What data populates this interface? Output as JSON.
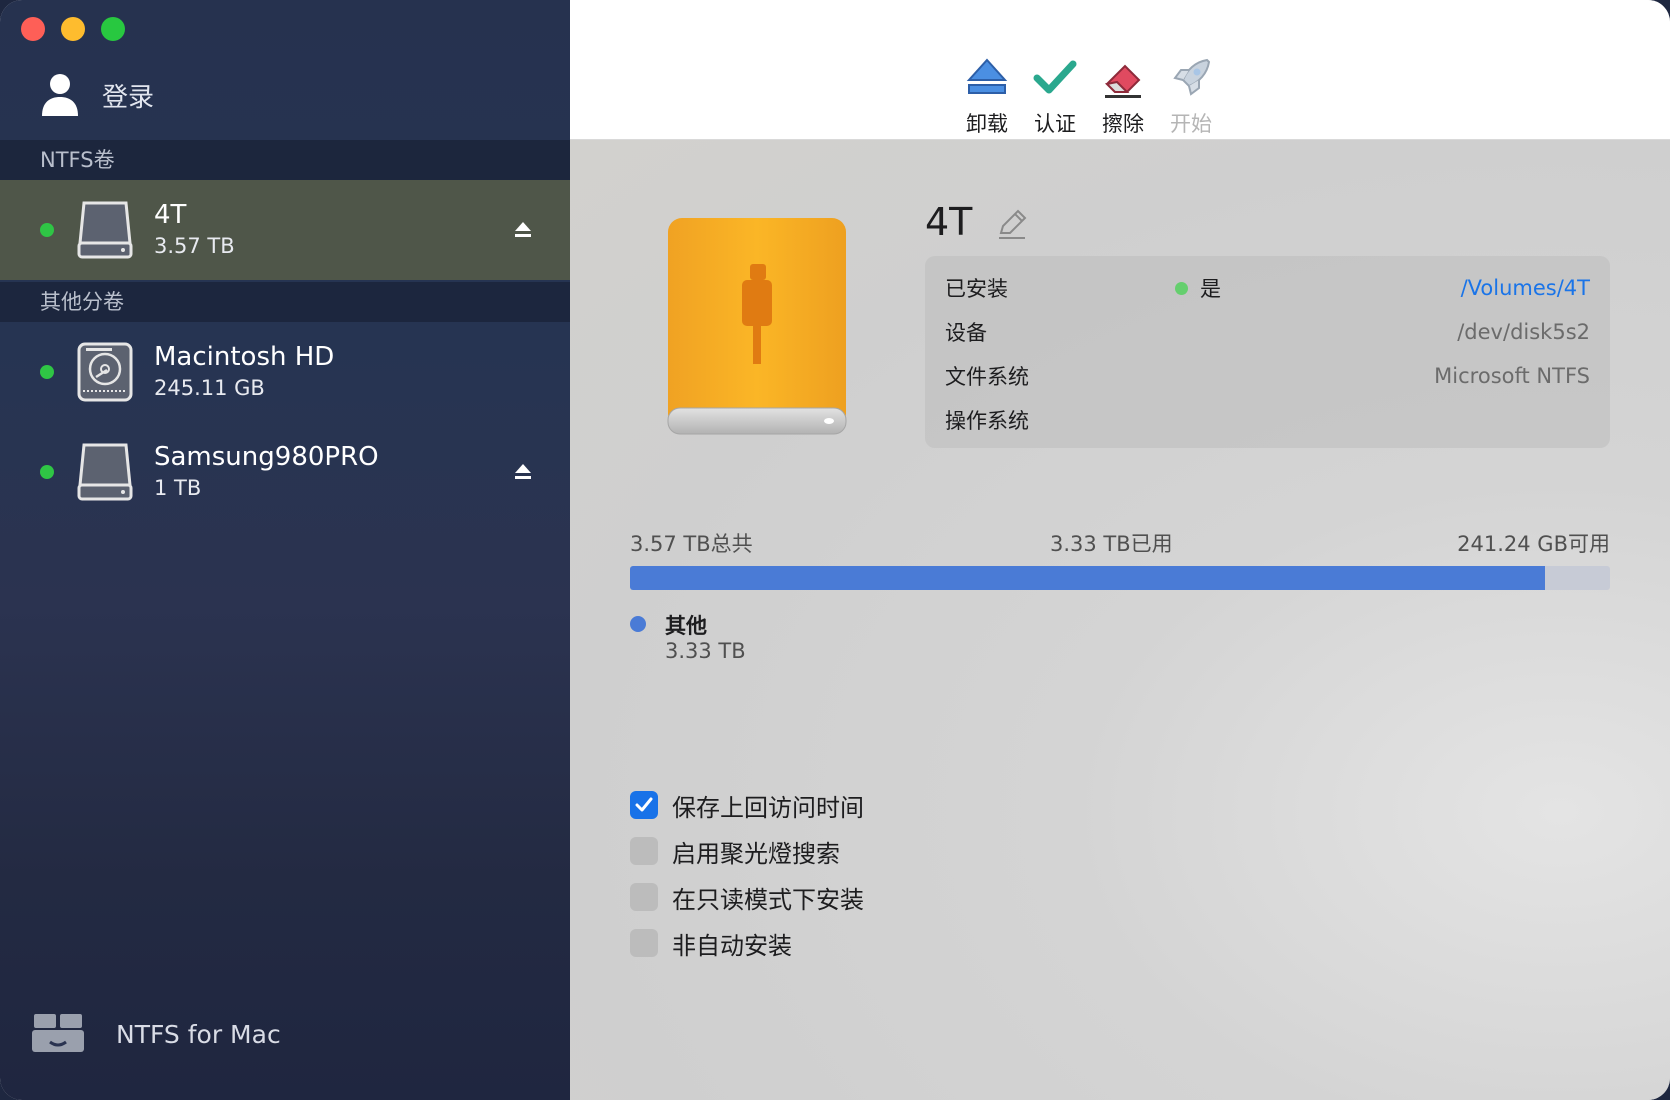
{
  "sidebar": {
    "login_label": "登录",
    "sections": [
      {
        "header": "NTFS卷",
        "volumes": [
          {
            "name": "4T",
            "size": "3.57 TB",
            "selected": true,
            "ejectable": true
          }
        ]
      },
      {
        "header": "其他分卷",
        "volumes": [
          {
            "name": "Macintosh HD",
            "size": "245.11 GB",
            "selected": false,
            "ejectable": false
          },
          {
            "name": "Samsung980PRO",
            "size": "1 TB",
            "selected": false,
            "ejectable": true
          }
        ]
      }
    ],
    "app_name": "NTFS for Mac"
  },
  "toolbar": {
    "unmount_label": "卸载",
    "verify_label": "认证",
    "erase_label": "擦除",
    "start_label": "开始"
  },
  "detail": {
    "volume_title": "4T",
    "info": {
      "mounted_label": "已安装",
      "mounted_value": "是",
      "mount_path": "/Volumes/4T",
      "device_label": "设备",
      "device_value": "/dev/disk5s2",
      "fs_label": "文件系统",
      "fs_value": "Microsoft NTFS",
      "os_label": "操作系统",
      "os_value": ""
    },
    "usage": {
      "total_label": "3.57 TB总共",
      "used_label": "3.33 TB已用",
      "free_label": "241.24 GB可用",
      "used_fraction": 0.934
    },
    "legend": {
      "name": "其他",
      "size": "3.33 TB"
    },
    "options": [
      {
        "label": "保存上回访问时间",
        "checked": true
      },
      {
        "label": "启用聚光燈搜索",
        "checked": false
      },
      {
        "label": "在只读模式下安装",
        "checked": false
      },
      {
        "label": "非自动安装",
        "checked": false
      }
    ]
  },
  "colors": {
    "accent": "#1872e8",
    "usage_fill": "#4a7bd6",
    "status_green": "#2fc545",
    "link": "#1a74e8"
  }
}
